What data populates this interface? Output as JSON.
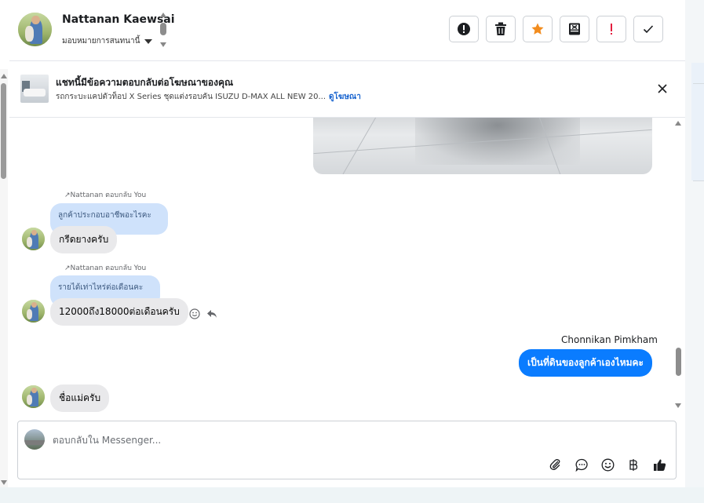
{
  "header": {
    "contact_name": "Nattanan Kaewsai",
    "assign_label": "มอบหมายการสนทนานี้",
    "toolbar": [
      {
        "name": "mark-spam-button",
        "icon": "alert-circle-icon"
      },
      {
        "name": "delete-button",
        "icon": "trash-icon"
      },
      {
        "name": "star-button",
        "icon": "star-icon",
        "color": "#f28c1e"
      },
      {
        "name": "archive-button",
        "icon": "archive-x-icon"
      },
      {
        "name": "important-button",
        "icon": "exclamation-icon",
        "color": "#e41e3f"
      },
      {
        "name": "done-button",
        "icon": "check-icon"
      }
    ]
  },
  "ad_banner": {
    "title": "แชทนี้มีข้อความตอบกลับต่อโฆษณาของคุณ",
    "subtitle": "รถกระบะแคปตัวท็อป X Series ชุดแต่งรอบคัน ISUZU D-MAX ALL NEW 20...",
    "link": "ดูโฆษณา"
  },
  "messages": [
    {
      "reply_meta": "Nattanan ตอบกลับ You",
      "quoted": "ลูกค้าประกอบอาชีพอะไรคะ",
      "text": "กรีดยางครับ"
    },
    {
      "reply_meta": "Nattanan ตอบกลับ You",
      "quoted": "รายได้เท่าไหร่ต่อเดือนคะ",
      "text": "12000ถึง18000ต่อเดือนครับ"
    },
    {
      "sender": "Chonnikan Pimkham",
      "text": "เป็นที่ดินของลูกค้าเองไหมคะ"
    },
    {
      "text": "ชื่อแม่ครับ"
    }
  ],
  "composer": {
    "placeholder": "ตอบกลับใน Messenger...",
    "tools": [
      "attachment-icon",
      "saved-reply-icon",
      "emoji-icon",
      "baht-icon",
      "thumbs-up-icon"
    ],
    "accent": "#1877f2"
  }
}
